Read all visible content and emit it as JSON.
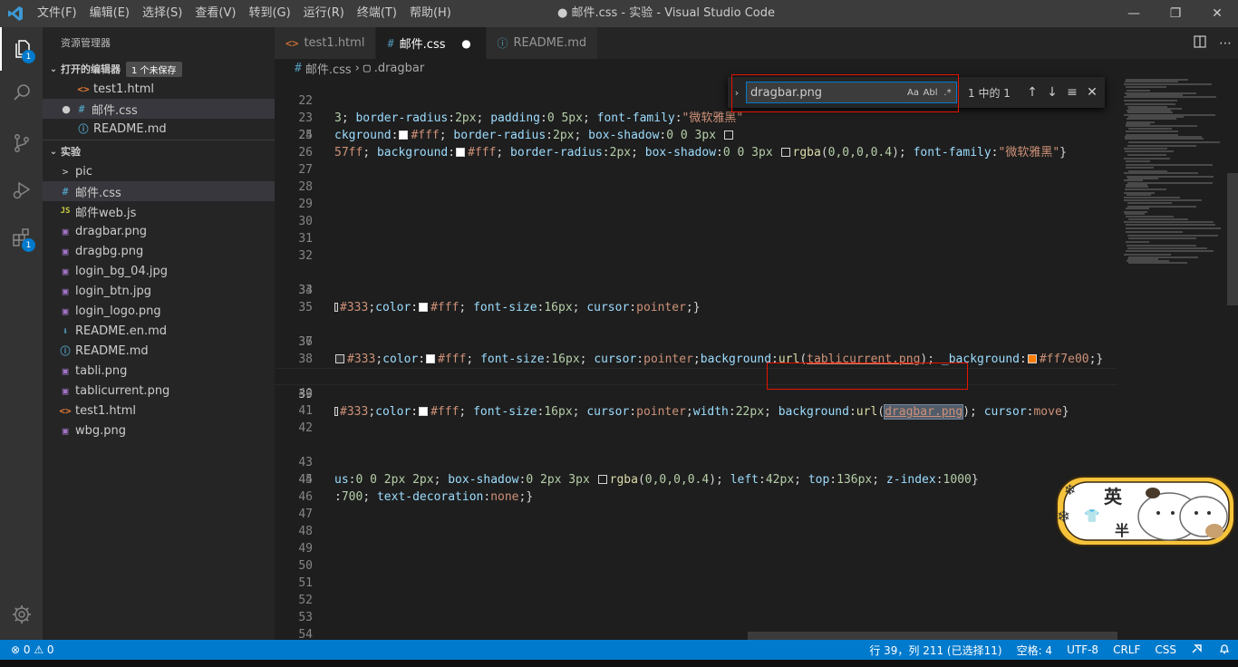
{
  "titlebar": {
    "menu": [
      "文件(F)",
      "编辑(E)",
      "选择(S)",
      "查看(V)",
      "转到(G)",
      "运行(R)",
      "终端(T)",
      "帮助(H)"
    ],
    "title": "● 邮件.css - 实验 - Visual Studio Code",
    "controls": {
      "minimize": "—",
      "maximize": "❐",
      "close": "✕"
    }
  },
  "activity": {
    "explorer_badge": "1",
    "extensions_badge": "1"
  },
  "sidebar": {
    "title": "资源管理器",
    "open_editors": {
      "header": "打开的编辑器",
      "badge": "1 个未保存",
      "items": [
        {
          "icon": "<>",
          "label": "test1.html"
        },
        {
          "icon": "#",
          "label": "邮件.css",
          "modified": "●"
        },
        {
          "icon": "ⓘ",
          "label": "README.md"
        }
      ]
    },
    "folder": {
      "header": "实验",
      "items": [
        {
          "icon": ">",
          "label": "pic",
          "type": "folder"
        },
        {
          "icon": "#",
          "label": "邮件.css",
          "type": "css"
        },
        {
          "icon": "JS",
          "label": "邮件web.js",
          "type": "js"
        },
        {
          "icon": "▣",
          "label": "dragbar.png",
          "type": "img"
        },
        {
          "icon": "▣",
          "label": "dragbg.png",
          "type": "img"
        },
        {
          "icon": "▣",
          "label": "login_bg_04.jpg",
          "type": "img"
        },
        {
          "icon": "▣",
          "label": "login_btn.jpg",
          "type": "img"
        },
        {
          "icon": "▣",
          "label": "login_logo.png",
          "type": "img"
        },
        {
          "icon": "⬇",
          "label": "README.en.md",
          "type": "md"
        },
        {
          "icon": "ⓘ",
          "label": "README.md",
          "type": "info"
        },
        {
          "icon": "▣",
          "label": "tabli.png",
          "type": "img"
        },
        {
          "icon": "▣",
          "label": "tablicurrent.png",
          "type": "img"
        },
        {
          "icon": "<>",
          "label": "test1.html",
          "type": "html"
        },
        {
          "icon": "▣",
          "label": "wbg.png",
          "type": "img"
        }
      ]
    }
  },
  "tabs": [
    {
      "icon": "<>",
      "label": "test1.html"
    },
    {
      "icon": "#",
      "label": "邮件.css",
      "modified": "●"
    },
    {
      "icon": "ⓘ",
      "label": "README.md"
    }
  ],
  "breadcrumb": {
    "file": "邮件.css",
    "symbol": ".dragbar"
  },
  "find": {
    "value": "dragbar.png",
    "opt_case": "Aa",
    "opt_word": "Abl",
    "opt_regex": ".*",
    "count": "1 中的 1"
  },
  "editor": {
    "line_numbers": [
      "22",
      "23",
      "24",
      "25",
      "26",
      "27",
      "28",
      "29",
      "30",
      "31",
      "32",
      "33",
      "34",
      "35",
      "36",
      "37",
      "38",
      "39",
      "40",
      "41",
      "42",
      "43",
      "44",
      "45",
      "46",
      "47",
      "48",
      "49",
      "50",
      "51",
      "52",
      "53",
      "54"
    ]
  },
  "status": {
    "problems": "⊗ 0 ⚠ 0",
    "position": "行 39，列 211 (已选择11)",
    "spaces": "空格: 4",
    "encoding": "UTF-8",
    "eol": "CRLF",
    "language": "CSS"
  },
  "ime": {
    "chars": [
      "英",
      "半"
    ]
  },
  "colors": {
    "accent": "#007acc",
    "highlight_border": "#e51400",
    "editor_bg": "#1e1e1e",
    "sidebar_bg": "#252526"
  }
}
